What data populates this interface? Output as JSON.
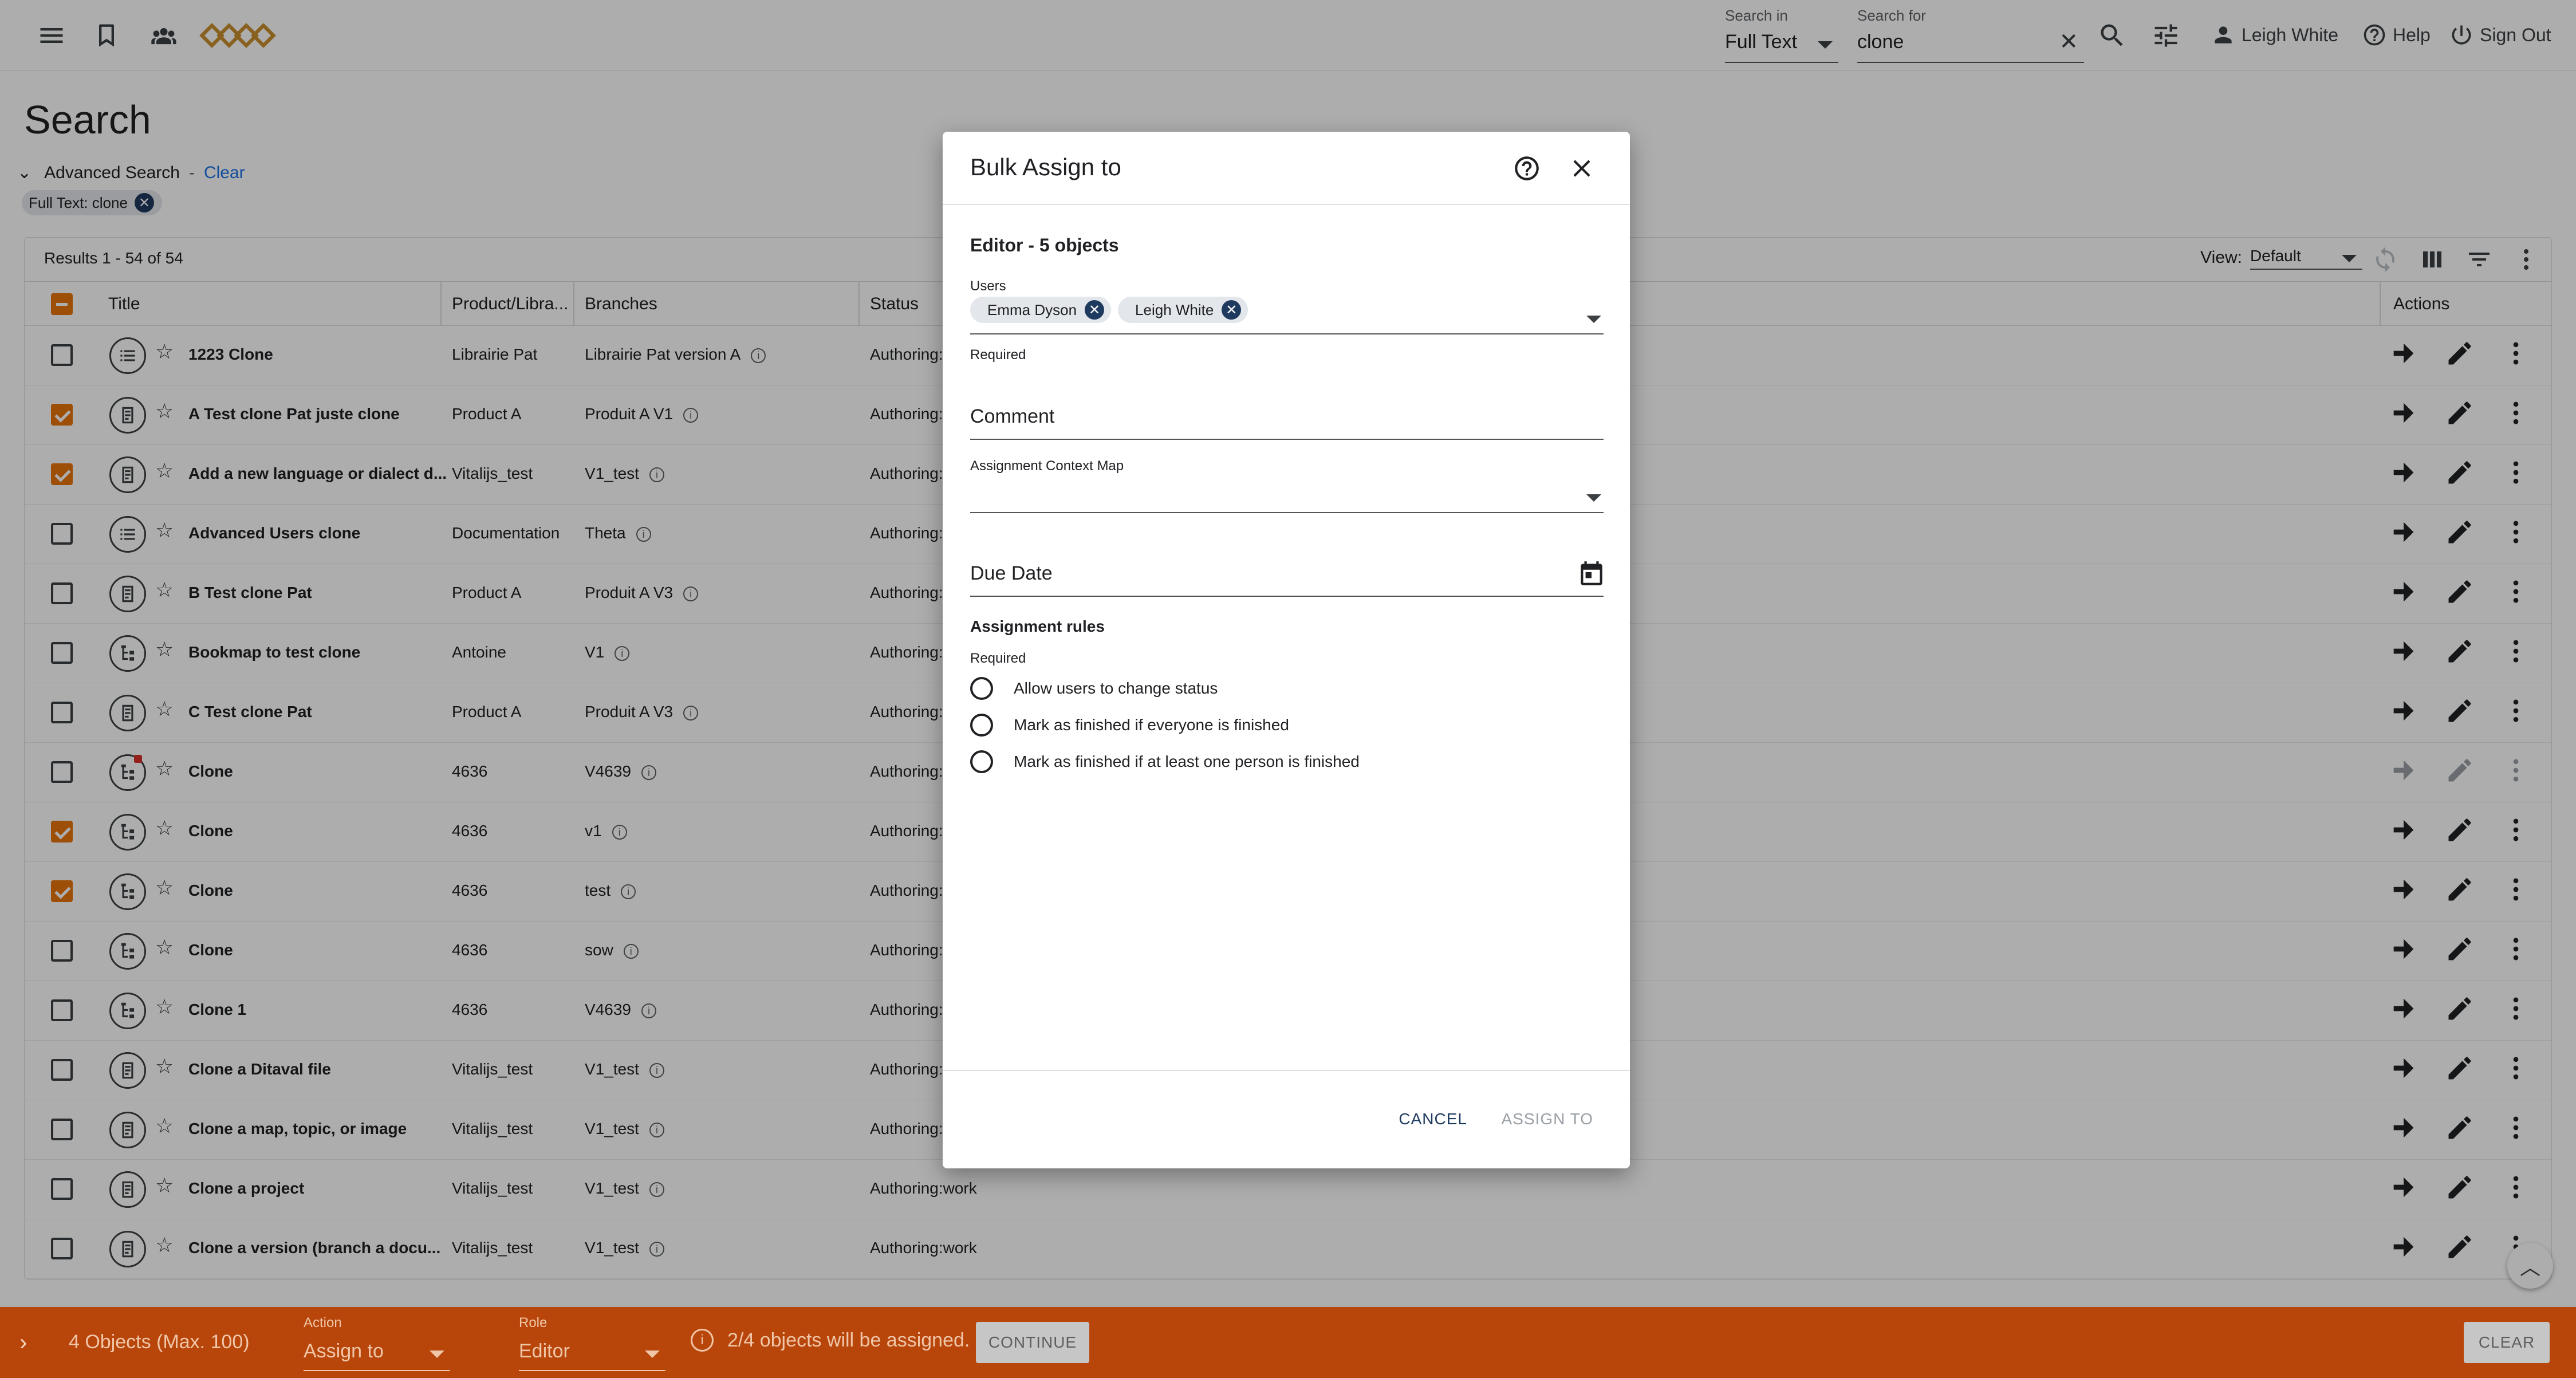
{
  "topbar": {
    "search_in_label": "Search in",
    "search_in_value": "Full Text",
    "search_for_label": "Search for",
    "search_for_value": "clone",
    "user_name": "Leigh White",
    "help_label": "Help",
    "signout_label": "Sign Out"
  },
  "page": {
    "title": "Search",
    "advanced_search_label": "Advanced Search",
    "separator": "-",
    "clear_label": "Clear",
    "filter_chip": "Full Text: clone"
  },
  "results": {
    "count_text": "Results 1 - 54 of 54",
    "view_label": "View:",
    "view_value": "Default"
  },
  "table": {
    "columns": [
      "Title",
      "Product/Libra...",
      "Branches",
      "Status",
      "Actions"
    ],
    "rows": [
      {
        "title": "1223 Clone",
        "product": "Librairie Pat",
        "branch": "Librairie Pat version A",
        "status": "Authoring:",
        "checked": false,
        "type": "list"
      },
      {
        "title": "A Test clone Pat juste clone",
        "product": "Product A",
        "branch": "Produit A V1",
        "status": "Authoring:",
        "checked": true,
        "type": "doc"
      },
      {
        "title": "Add a new language or dialect d...",
        "product": "Vitalijs_test",
        "branch": "V1_test",
        "status": "Authoring:",
        "checked": true,
        "type": "doc"
      },
      {
        "title": "Advanced Users clone",
        "product": "Documentation",
        "branch": "Theta",
        "status": "Authoring:",
        "checked": false,
        "type": "list"
      },
      {
        "title": "B Test clone Pat",
        "product": "Product A",
        "branch": "Produit A V3",
        "status": "Authoring:",
        "checked": false,
        "type": "doc"
      },
      {
        "title": "Bookmap to test clone",
        "product": "Antoine",
        "branch": "V1",
        "status": "Authoring:",
        "checked": false,
        "type": "map"
      },
      {
        "title": "C Test clone Pat",
        "product": "Product A",
        "branch": "Produit A V3",
        "status": "Authoring:",
        "checked": false,
        "type": "doc"
      },
      {
        "title": "Clone",
        "product": "4636",
        "branch": "V4639",
        "status": "Authoring:",
        "checked": false,
        "type": "map",
        "locked": true
      },
      {
        "title": "Clone",
        "product": "4636",
        "branch": "v1",
        "status": "Authoring:",
        "checked": true,
        "type": "map"
      },
      {
        "title": "Clone",
        "product": "4636",
        "branch": "test",
        "status": "Authoring:",
        "checked": true,
        "type": "map"
      },
      {
        "title": "Clone",
        "product": "4636",
        "branch": "sow",
        "status": "Authoring:",
        "checked": false,
        "type": "map"
      },
      {
        "title": "Clone 1",
        "product": "4636",
        "branch": "V4639",
        "status": "Authoring:",
        "checked": false,
        "type": "map"
      },
      {
        "title": "Clone a Ditaval file",
        "product": "Vitalijs_test",
        "branch": "V1_test",
        "status": "Authoring:",
        "checked": false,
        "type": "doc"
      },
      {
        "title": "Clone a map, topic, or image",
        "product": "Vitalijs_test",
        "branch": "V1_test",
        "status": "Authoring:",
        "checked": false,
        "type": "doc"
      },
      {
        "title": "Clone a project",
        "product": "Vitalijs_test",
        "branch": "V1_test",
        "status": "Authoring:work",
        "checked": false,
        "type": "doc"
      },
      {
        "title": "Clone a version (branch a docu...",
        "product": "Vitalijs_test",
        "branch": "V1_test",
        "status": "Authoring:work",
        "checked": false,
        "type": "doc"
      }
    ]
  },
  "modal": {
    "title": "Bulk Assign to",
    "subtitle": "Editor - 5 objects",
    "users_label": "Users",
    "users": [
      "Emma Dyson",
      "Leigh White"
    ],
    "required": "Required",
    "comment_placeholder": "Comment",
    "context_map_label": "Assignment Context Map",
    "due_date_placeholder": "Due Date",
    "rules_heading": "Assignment rules",
    "rules": [
      "Allow users to change status",
      "Mark as finished if everyone is finished",
      "Mark as finished if at least one person is finished"
    ],
    "cancel_label": "CANCEL",
    "assign_label": "ASSIGN TO"
  },
  "bottombar": {
    "objects_count": "4 Objects (Max. 100)",
    "action_label": "Action",
    "action_value": "Assign to",
    "role_label": "Role",
    "role_value": "Editor",
    "note": "2/4 objects will be assigned.",
    "continue_label": "CONTINUE",
    "clear_label": "CLEAR"
  }
}
